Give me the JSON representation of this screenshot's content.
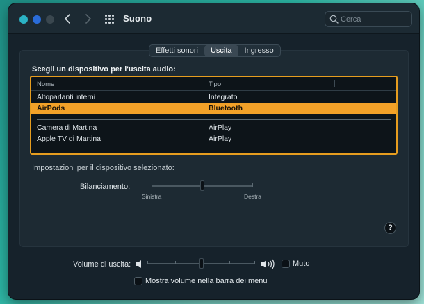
{
  "window": {
    "title": "Suono",
    "traffic_light_colors": [
      "#2bb3c5",
      "#2a6cd9",
      "#3a474f"
    ]
  },
  "search": {
    "placeholder": "Cerca"
  },
  "tabs": [
    {
      "label": "Effetti sonori",
      "active": false
    },
    {
      "label": "Uscita",
      "active": true
    },
    {
      "label": "Ingresso",
      "active": false
    }
  ],
  "output": {
    "heading": "Scegli un dispositivo per l'uscita audio:",
    "columns": [
      "Nome",
      "Tipo"
    ],
    "devices": [
      {
        "name": "Altoparlanti interni",
        "type": "Integrato",
        "selected": false
      },
      {
        "name": "AirPods",
        "type": "Bluetooth",
        "selected": true
      },
      {
        "name": "Camera di Martina",
        "type": "AirPlay",
        "selected": false
      },
      {
        "name": "Apple TV di Martina",
        "type": "AirPlay",
        "selected": false
      }
    ],
    "highlight_color": "#f2a128"
  },
  "settings": {
    "heading": "Impostazioni per il dispositivo selezionato:",
    "balance_label": "Bilanciamento:",
    "balance_left": "Sinistra",
    "balance_right": "Destra",
    "balance_value": 0.5
  },
  "help_label": "?",
  "volume": {
    "label": "Volume di uscita:",
    "value": 0.5,
    "mute_label": "Muto",
    "mute_checked": false,
    "menu_bar_label": "Mostra volume nella barra dei menu",
    "menu_bar_checked": false
  }
}
